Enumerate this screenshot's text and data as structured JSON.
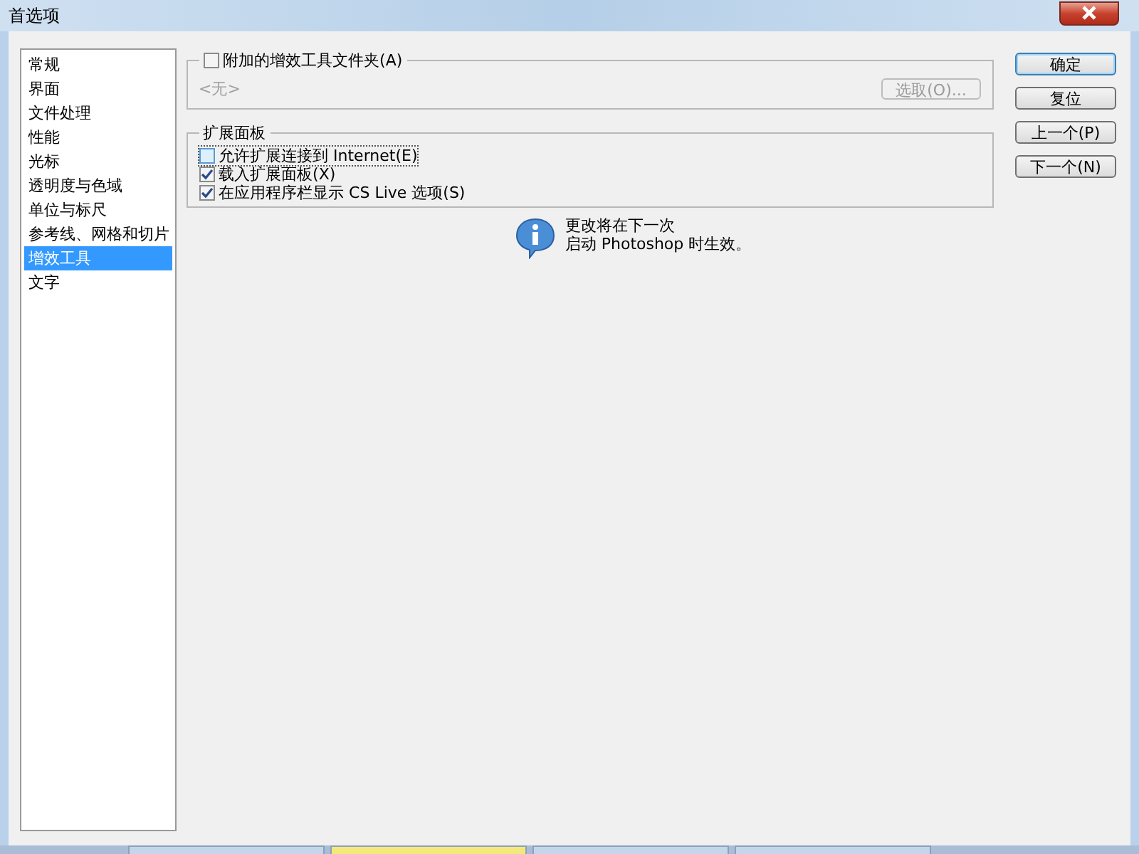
{
  "window": {
    "title": "首选项"
  },
  "sidebar": {
    "items": [
      {
        "label": "常规",
        "selected": false
      },
      {
        "label": "界面",
        "selected": false
      },
      {
        "label": "文件处理",
        "selected": false
      },
      {
        "label": "性能",
        "selected": false
      },
      {
        "label": "光标",
        "selected": false
      },
      {
        "label": "透明度与色域",
        "selected": false
      },
      {
        "label": "单位与标尺",
        "selected": false
      },
      {
        "label": "参考线、网格和切片",
        "selected": false
      },
      {
        "label": "增效工具",
        "selected": true
      },
      {
        "label": "文字",
        "selected": false
      }
    ]
  },
  "plugins_folder": {
    "label": "附加的增效工具文件夹(A)",
    "checked": false,
    "path": "<无>",
    "choose_button": {
      "label": "选取(O)...",
      "disabled": true
    }
  },
  "extension_panels": {
    "title": "扩展面板",
    "options": [
      {
        "label": "允许扩展连接到 Internet(E)",
        "checked": false,
        "focused": true
      },
      {
        "label": "载入扩展面板(X)",
        "checked": true,
        "focused": false
      },
      {
        "label": "在应用程序栏显示 CS Live 选项(S)",
        "checked": true,
        "focused": false
      }
    ]
  },
  "notice": {
    "lines": [
      "更改将在下一次",
      "启动 Photoshop 时生效。"
    ]
  },
  "buttons": [
    {
      "label": "确定",
      "default": true
    },
    {
      "label": "复位",
      "default": false
    },
    {
      "label": "上一个(P)",
      "default": false
    },
    {
      "label": "下一个(N)",
      "default": false
    }
  ]
}
